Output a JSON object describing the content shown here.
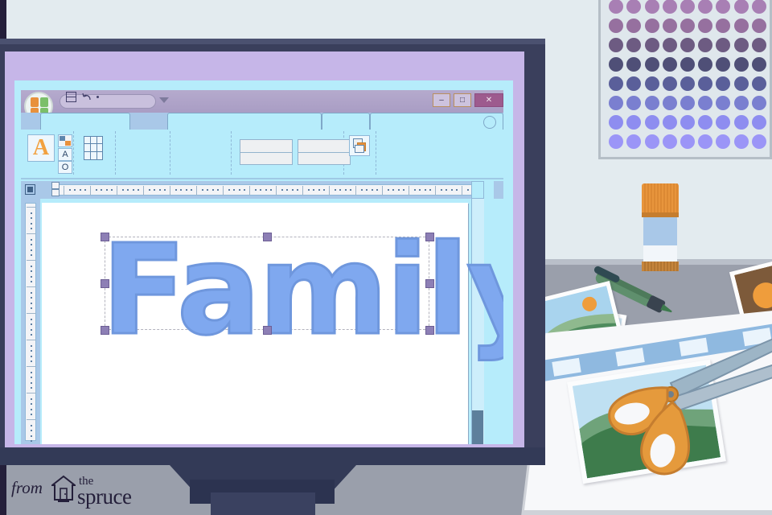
{
  "scene": {
    "title": "Desktop publishing on a computer monitor with scrapbooking supplies",
    "setting": "craft desk with monitor, glue stick, marker, photos and scissors"
  },
  "colors": {
    "wall": "#e3ebef",
    "desk": "#9a9fab",
    "desk_edge": "#b9bfc9",
    "monitor_bezel": "#3a3f5c",
    "monitor_inner_frame": "#c6b6e8",
    "screen": "#b6ecfb",
    "titlebar": "#a99dc4",
    "close_button": "#9d5b8e",
    "ribbon": "#b6ecfb",
    "ruler_band": "#a9c8e8",
    "page": "#ffffff",
    "text_blue": "#7fa8ef",
    "text_blue_outline": "#6f97dd",
    "handle_purple": "#8d7fb5",
    "accent_orange": "#e8953c",
    "scissor_blade": "#9db5c6",
    "pen_green": "#5f8f6d",
    "logo_ink": "#241f3a"
  },
  "poster": {
    "name": "dot-grid-poster",
    "rows": 8,
    "columns": 9,
    "row_colors": [
      "#a87fb4",
      "#96709f",
      "#6d5b82",
      "#4f4f77",
      "#5a5f9a",
      "#7a7fd0",
      "#8e8df0",
      "#9b95f7"
    ]
  },
  "app_window": {
    "office_orb": "office-orb",
    "quick_access": [
      {
        "icon": "save-icon",
        "label": "Save"
      },
      {
        "icon": "undo-icon",
        "label": "Undo"
      },
      {
        "icon": "customize-caret-icon",
        "label": "Customize Quick Access Toolbar"
      }
    ],
    "window_controls": [
      {
        "name": "minimize-button",
        "glyph": "–"
      },
      {
        "name": "restore-button",
        "glyph": "□"
      },
      {
        "name": "close-button",
        "glyph": "✕"
      }
    ],
    "ribbon_tabs": [
      {
        "name": "tab-home",
        "label": ""
      },
      {
        "name": "tab-insert",
        "label": ""
      },
      {
        "name": "tab-page-design",
        "label": ""
      },
      {
        "name": "tab-view",
        "label": ""
      }
    ],
    "ribbon_groups": [
      {
        "name": "group-font",
        "controls": [
          "wordart-A-button",
          "color-swatch-icon",
          "text-style-icon",
          "shape-outline-icon"
        ]
      },
      {
        "name": "group-table",
        "controls": [
          "insert-table-icon"
        ]
      },
      {
        "name": "group-blank",
        "controls": []
      },
      {
        "name": "group-styles",
        "controls": [
          "style-gallery-1",
          "style-gallery-2"
        ]
      },
      {
        "name": "group-arrange",
        "controls": [
          "arrange-objects-icon"
        ]
      }
    ],
    "help_button": "help-circle-icon"
  },
  "document": {
    "object_text": "Family",
    "selection": {
      "state": "selected",
      "handle_count": 8,
      "border_style": "dashed"
    },
    "rulers": {
      "horizontal": "horizontal-ruler",
      "vertical": "vertical-ruler",
      "indent_markers": [
        "first-line-indent",
        "left-indent",
        "right-indent"
      ]
    },
    "scrollbar": {
      "name": "vertical-scrollbar",
      "thumb_position": "bottom"
    }
  },
  "desk_items": [
    {
      "name": "glue-stick",
      "cap_color": "#e8953c",
      "body_color": "#a9c8e8"
    },
    {
      "name": "green-marker-pen",
      "color": "#5f8f6d"
    },
    {
      "name": "photo-sunset-hills",
      "subject": "orange sun over green hills"
    },
    {
      "name": "photo-blue-mountains",
      "subject": "teal mountain landscape"
    },
    {
      "name": "photo-portrait",
      "subject": "portrait on brown background"
    },
    {
      "name": "scrapbook-page",
      "subject": "album page with blue washi stripe"
    },
    {
      "name": "scrapbook-photo",
      "subject": "green hills under blue sky"
    },
    {
      "name": "orange-scissors",
      "handle_color": "#e59a3c",
      "blade_color": "#9db5c6"
    }
  ],
  "logo": {
    "from": "from",
    "the": "the",
    "spruce": "spruce",
    "icon": "house-icon"
  }
}
